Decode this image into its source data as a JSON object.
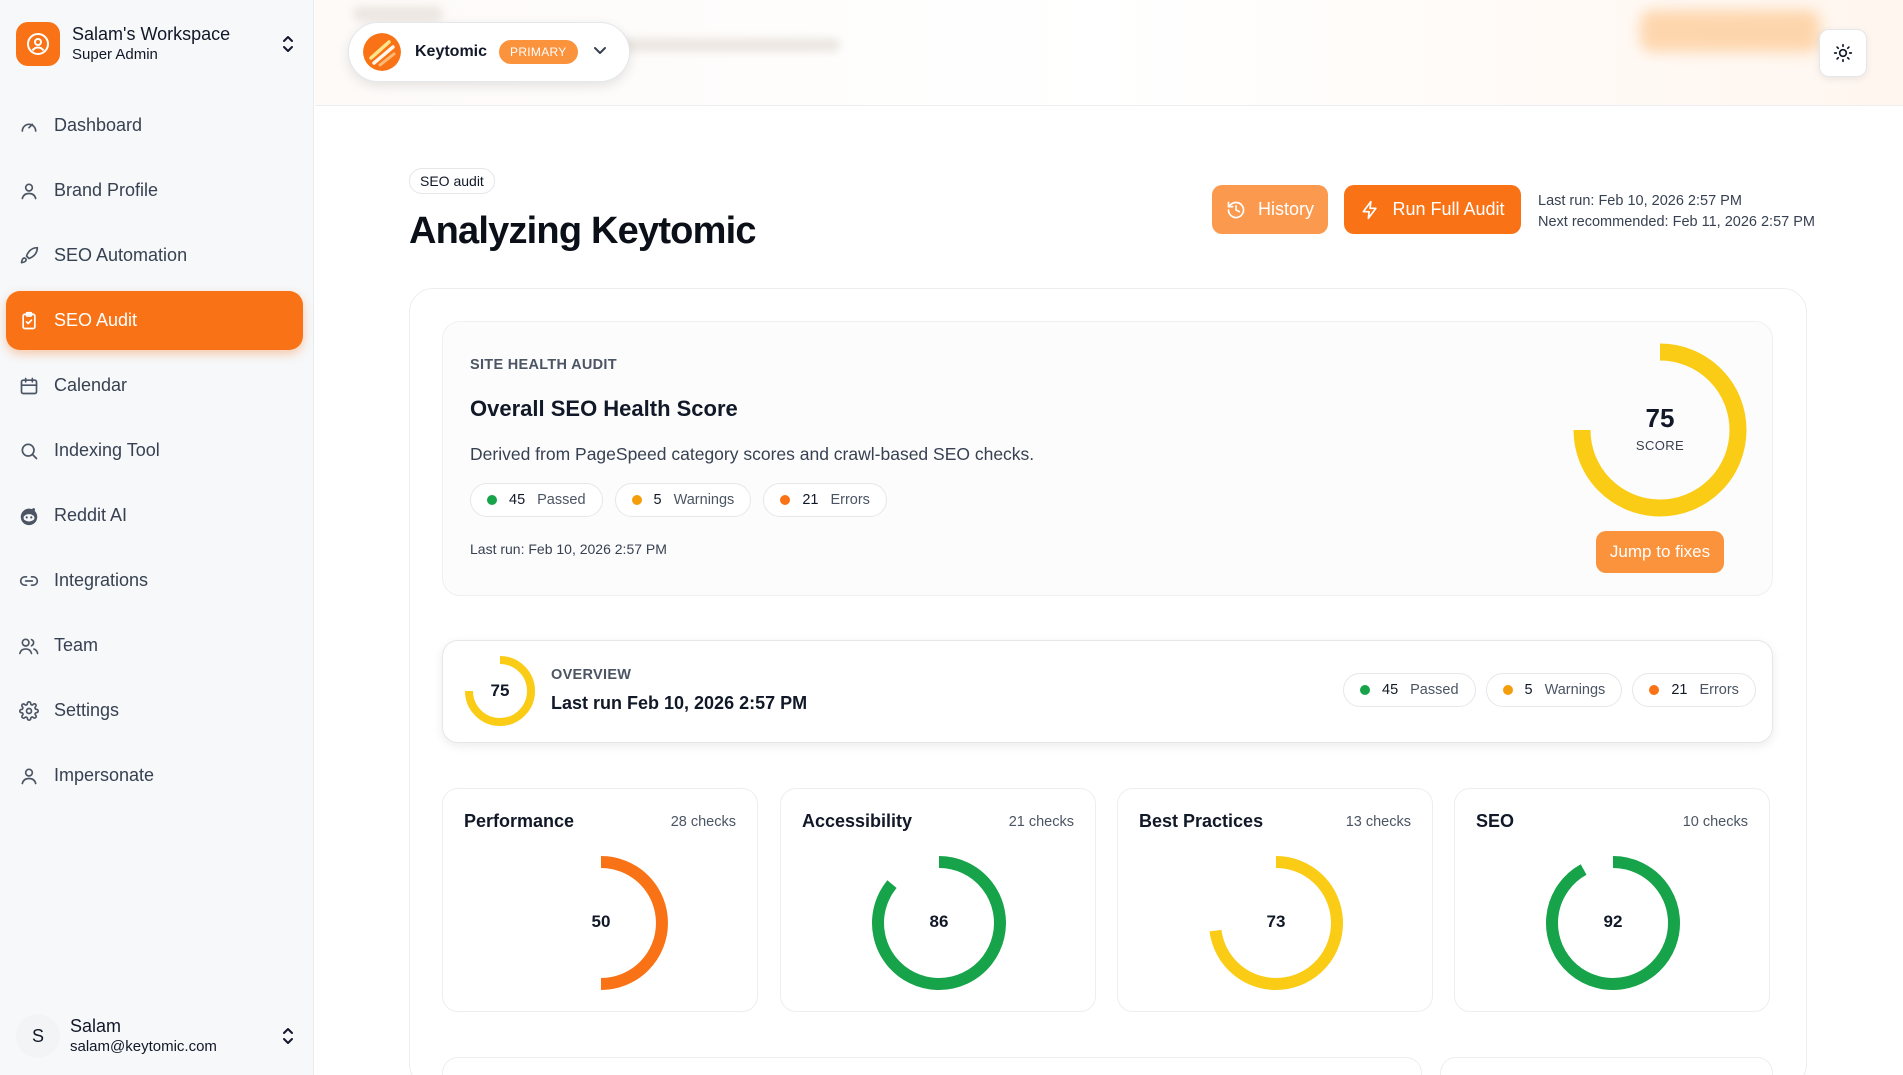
{
  "workspace": {
    "name": "Salam's Workspace",
    "role": "Super Admin"
  },
  "nav": [
    {
      "label": "Dashboard",
      "icon": "gauge-icon"
    },
    {
      "label": "Brand Profile",
      "icon": "user-icon"
    },
    {
      "label": "SEO Automation",
      "icon": "rocket-icon"
    },
    {
      "label": "SEO Audit",
      "icon": "clipboard-check-icon",
      "active": true
    },
    {
      "label": "Calendar",
      "icon": "calendar-icon"
    },
    {
      "label": "Indexing Tool",
      "icon": "search-icon"
    },
    {
      "label": "Reddit AI",
      "icon": "reddit-icon"
    },
    {
      "label": "Integrations",
      "icon": "link-icon"
    },
    {
      "label": "Team",
      "icon": "users-icon"
    },
    {
      "label": "Settings",
      "icon": "gear-icon"
    },
    {
      "label": "Impersonate",
      "icon": "user-icon"
    }
  ],
  "user": {
    "initial": "S",
    "name": "Salam",
    "email": "salam@keytomic.com"
  },
  "brand": {
    "name": "Keytomic",
    "badge": "PRIMARY"
  },
  "header": {
    "tag": "SEO audit",
    "title": "Analyzing Keytomic",
    "history_label": "History",
    "run_label": "Run Full Audit",
    "last_run": "Last run: Feb 10, 2026 2:57 PM",
    "next_recommended": "Next recommended: Feb 11, 2026 2:57 PM"
  },
  "health": {
    "label": "SITE HEALTH AUDIT",
    "title": "Overall SEO Health Score",
    "description": "Derived from PageSpeed category scores and crawl-based SEO checks.",
    "passed": "45",
    "passed_label": "Passed",
    "warnings": "5",
    "warnings_label": "Warnings",
    "errors": "21",
    "errors_label": "Errors",
    "last_run": "Last run: Feb 10, 2026 2:57 PM",
    "score": 75,
    "score_text": "75",
    "score_label": "SCORE",
    "jump_label": "Jump to fixes"
  },
  "overview": {
    "score": 75,
    "score_text": "75",
    "label": "OVERVIEW",
    "title": "Last run Feb 10, 2026 2:57 PM",
    "passed": "45",
    "passed_label": "Passed",
    "warnings": "5",
    "warnings_label": "Warnings",
    "errors": "21",
    "errors_label": "Errors"
  },
  "categories": [
    {
      "name": "Performance",
      "checks": "28 checks",
      "score": 50,
      "score_text": "50",
      "color": "#f97316"
    },
    {
      "name": "Accessibility",
      "checks": "21 checks",
      "score": 86,
      "score_text": "86",
      "color": "#16a34a"
    },
    {
      "name": "Best Practices",
      "checks": "13 checks",
      "score": 73,
      "score_text": "73",
      "color": "#facc15"
    },
    {
      "name": "SEO",
      "checks": "10 checks",
      "score": 92,
      "score_text": "92",
      "color": "#16a34a"
    }
  ],
  "colors": {
    "accent": "#f97316",
    "passed": "#16a34a",
    "warning": "#f59e0b",
    "error": "#f97316",
    "score_mid": "#facc15"
  }
}
